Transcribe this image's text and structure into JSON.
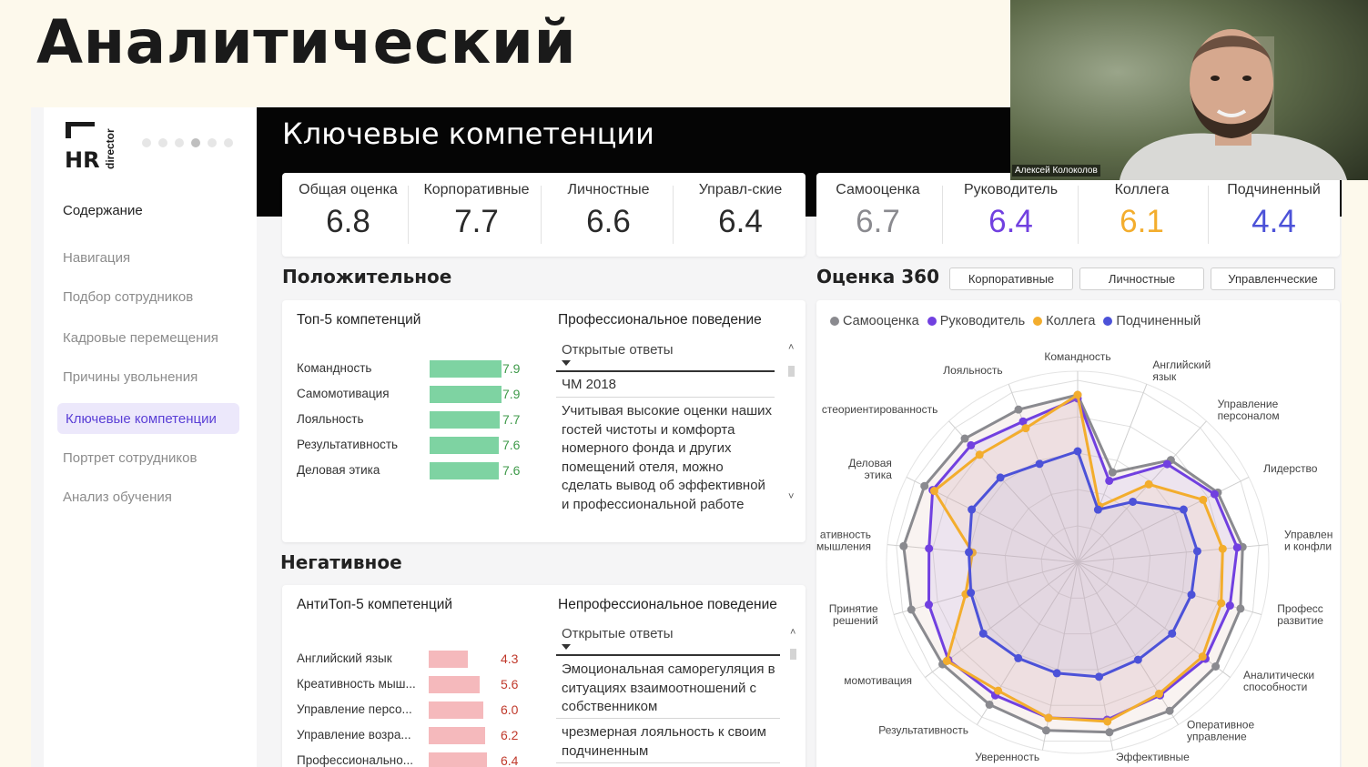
{
  "slide_title": "Аналитический",
  "video": {
    "name": "Алексей Колоколов"
  },
  "sidebar": {
    "logo_text": "HR",
    "logo_sub": "director",
    "heading": "Содержание",
    "items": [
      {
        "label": "Навигация"
      },
      {
        "label": "Подбор сотрудников"
      },
      {
        "label": "Кадровые перемещения"
      },
      {
        "label": "Причины увольнения"
      },
      {
        "label": "Ключевые компетенции"
      },
      {
        "label": "Портрет сотрудников"
      },
      {
        "label": "Анализ обучения"
      }
    ]
  },
  "header": {
    "title": "Ключевые компетенции"
  },
  "kpi_left": [
    {
      "label": "Общая оценка",
      "value": "6.8"
    },
    {
      "label": "Корпоративные",
      "value": "7.7"
    },
    {
      "label": "Личностные",
      "value": "6.6"
    },
    {
      "label": "Управл-ские",
      "value": "6.4"
    }
  ],
  "kpi_right": [
    {
      "label": "Самооценка",
      "value": "6.7",
      "color": "#8a8a8f"
    },
    {
      "label": "Руководитель",
      "value": "6.4",
      "color": "#7140e0"
    },
    {
      "label": "Коллега",
      "value": "6.1",
      "color": "#f3ad2d"
    },
    {
      "label": "Подчиненный",
      "value": "4.4",
      "color": "#4c52d8"
    }
  ],
  "positive": {
    "title": "Положительное",
    "top5_title": "Топ-5 компетенций",
    "items": [
      {
        "label": "Командность",
        "value": "7.9"
      },
      {
        "label": "Самомотивация",
        "value": "7.9"
      },
      {
        "label": "Лояльность",
        "value": "7.7"
      },
      {
        "label": "Результативность",
        "value": "7.6"
      },
      {
        "label": "Деловая этика",
        "value": "7.6"
      }
    ],
    "behavior_title": "Профессиональное поведение",
    "dropdown": "Открытые ответы",
    "answers": [
      "ЧМ 2018",
      "Учитывая высокие оценки наших гостей чистоты и комфорта номерного фонда и других помещений отеля, можно сделать вывод об эффективной и профессиональной работе"
    ]
  },
  "negative": {
    "title": "Негативное",
    "antitop_title": "АнтиТоп-5 компетенций",
    "items": [
      {
        "label": "Английский язык",
        "value": "4.3"
      },
      {
        "label": "Креативность мыш...",
        "value": "5.6"
      },
      {
        "label": "Управление персо...",
        "value": "6.0"
      },
      {
        "label": "Управление возра...",
        "value": "6.2"
      },
      {
        "label": "Профессионально...",
        "value": "6.4"
      }
    ],
    "behavior_title": "Непрофессиональное поведение",
    "dropdown": "Открытые ответы",
    "answers": [
      "Эмоциональная саморегуляция в ситуациях взаимоотношений с собственником",
      "чрезмерная лояльность к своим подчиненным"
    ]
  },
  "radar": {
    "title": "Оценка 360",
    "filters": [
      "Корпоративные",
      "Личностные",
      "Управленческие"
    ],
    "legend": [
      {
        "name": "Самооценка",
        "color": "#8a8a8f"
      },
      {
        "name": "Руководитель",
        "color": "#7140e0"
      },
      {
        "name": "Коллега",
        "color": "#f3ad2d"
      },
      {
        "name": "Подчиненный",
        "color": "#4c52d8"
      }
    ]
  },
  "chart_data": {
    "type": "radar",
    "axes": [
      "Командность",
      "Английский язык",
      "Управление персоналом",
      "Лидерство",
      "Управлен и конфли",
      "Професс развитие",
      "Аналитически способности",
      "Оперативное управление",
      "Эффективные",
      "Уверенность",
      "Результативность",
      "момотивация",
      "Принятие решений",
      "ативность мышления",
      "Деловая этика",
      "стеориентированность",
      "Лояльность"
    ],
    "rlim": [
      0,
      10
    ],
    "series": [
      {
        "name": "Самооценка",
        "values": [
          9.2,
          5.3,
          7.6,
          8.6,
          9.1,
          9.3,
          9.5,
          9.6,
          9.5,
          9.4,
          9.2,
          9.3,
          9.5,
          9.6,
          9.4,
          9.2,
          9.0
        ]
      },
      {
        "name": "Руководитель",
        "values": [
          9.0,
          4.8,
          7.3,
          8.4,
          8.8,
          8.7,
          8.8,
          8.6,
          8.8,
          8.7,
          8.6,
          8.9,
          8.5,
          8.2,
          8.9,
          8.7,
          8.3
        ]
      },
      {
        "name": "Коллега",
        "values": [
          9.2,
          3.3,
          5.8,
          7.7,
          8.0,
          8.2,
          8.6,
          8.5,
          8.9,
          8.7,
          8.3,
          9.0,
          6.4,
          5.8,
          8.8,
          8.0,
          7.9
        ]
      },
      {
        "name": "Подчиненный",
        "values": [
          6.1,
          3.1,
          4.5,
          6.5,
          6.6,
          6.5,
          6.5,
          6.3,
          6.4,
          6.2,
          6.2,
          6.5,
          6.1,
          6.0,
          6.5,
          6.3,
          5.8
        ]
      }
    ]
  }
}
